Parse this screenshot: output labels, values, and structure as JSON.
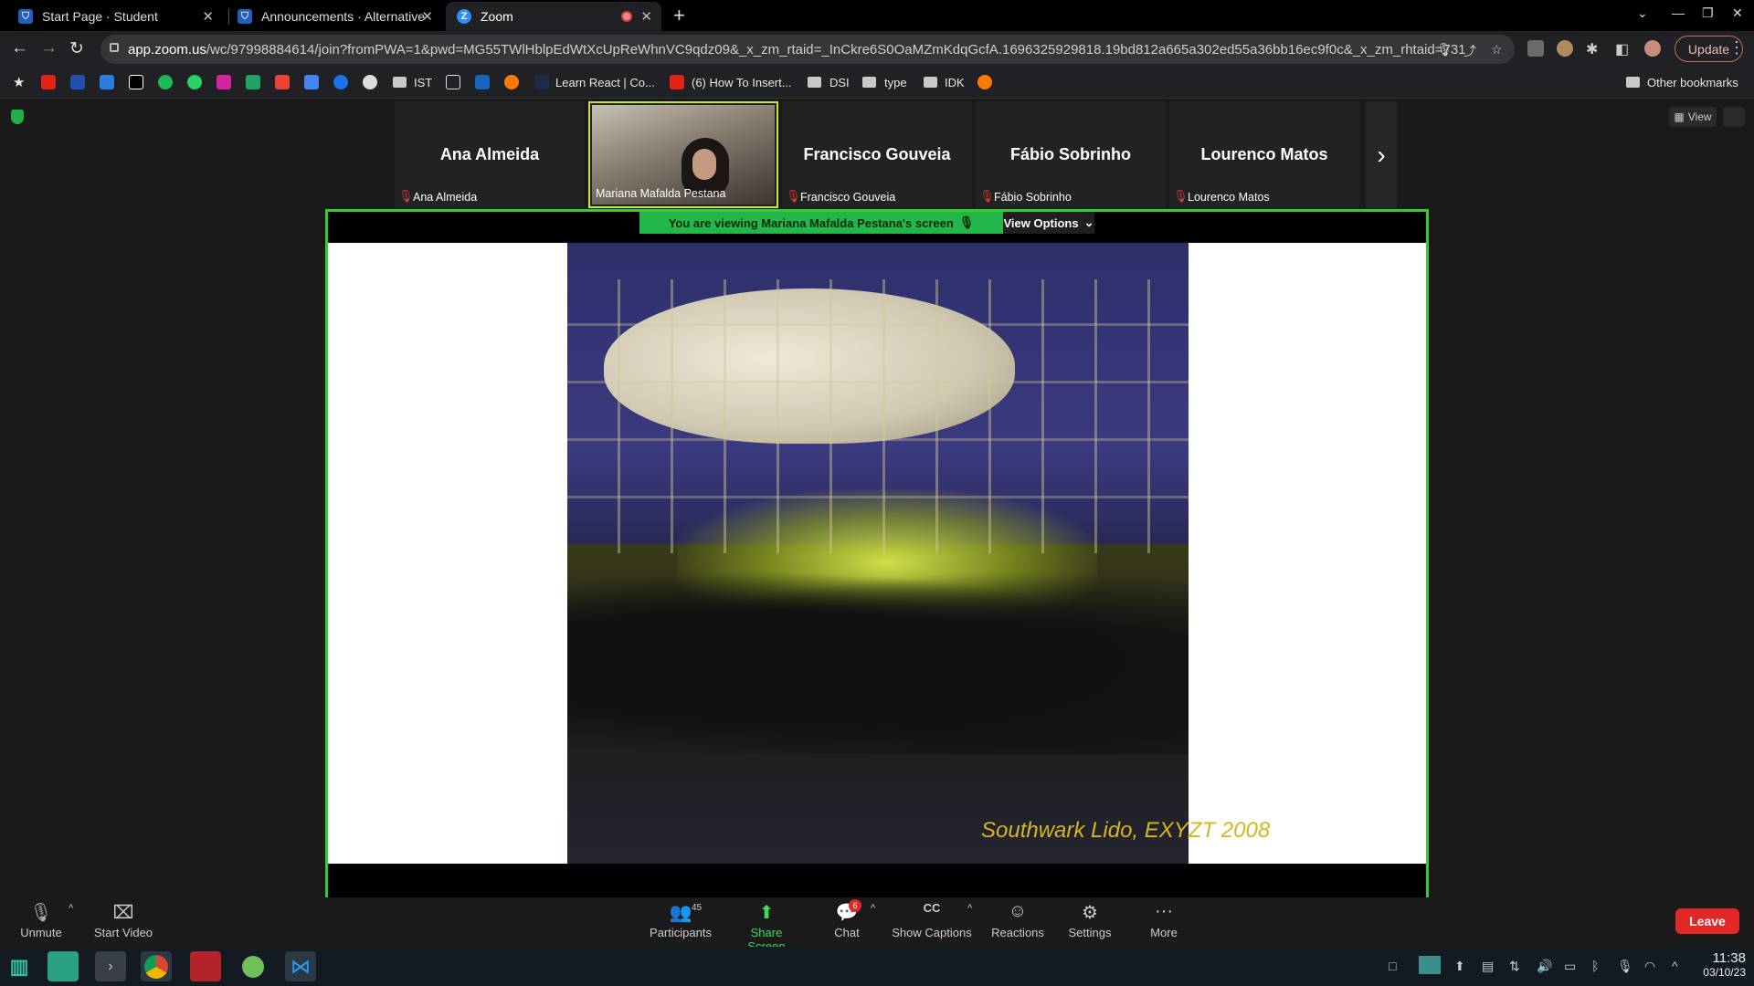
{
  "browser": {
    "tabs": [
      {
        "title": "Start Page · Student",
        "icon": "shield-icon"
      },
      {
        "title": "Announcements · Alternative",
        "icon": "shield-icon"
      },
      {
        "title": "Zoom",
        "icon": "zoom-icon"
      }
    ],
    "url_domain": "app.zoom.us",
    "url_path": "/wc/97998884614/join?fromPWA=1&pwd=MG55TWlHblpEdWtXcUpReWhnVC9qdz09&_x_zm_rtaid=_InCkre6S0OaMZmKdqGcfA.1696325929818.19bd812a665a302ed55a36bb16ec9f0c&_x_zm_rhtaid=731",
    "update_label": "Update",
    "bookmarks": [
      "IST",
      "Learn React | Co...",
      "(6) How To Insert...",
      "DSI",
      "type",
      "IDK"
    ],
    "other_bookmarks": "Other bookmarks"
  },
  "zoom": {
    "view_label": "View",
    "participants_strip": [
      {
        "big": "Ana Almeida",
        "name": "Ana Almeida",
        "muted": true
      },
      {
        "big": "",
        "name": "Mariana Mafalda Pestana",
        "muted": false,
        "video": true
      },
      {
        "big": "Francisco Gouveia",
        "name": "Francisco Gouveia",
        "muted": true
      },
      {
        "big": "Fábio Sobrinho",
        "name": "Fábio Sobrinho",
        "muted": true
      },
      {
        "big": "Lourenco Matos",
        "name": "Lourenco Matos",
        "muted": true
      }
    ],
    "share_banner": "You are viewing  Mariana Mafalda Pestana's screen",
    "view_options": "View Options",
    "slide_caption": "Southwark Lido, EXYZT 2008",
    "controls": {
      "unmute": "Unmute",
      "start_video": "Start Video",
      "participants": "Participants",
      "participants_count": "45",
      "share_screen": "Share Screen",
      "chat": "Chat",
      "chat_badge": "6",
      "show_captions": "Show Captions",
      "reactions": "Reactions",
      "settings": "Settings",
      "more": "More",
      "leave": "Leave"
    },
    "accent": "#32cd32"
  },
  "taskbar": {
    "time": "11:38",
    "date": "03/10/23"
  }
}
